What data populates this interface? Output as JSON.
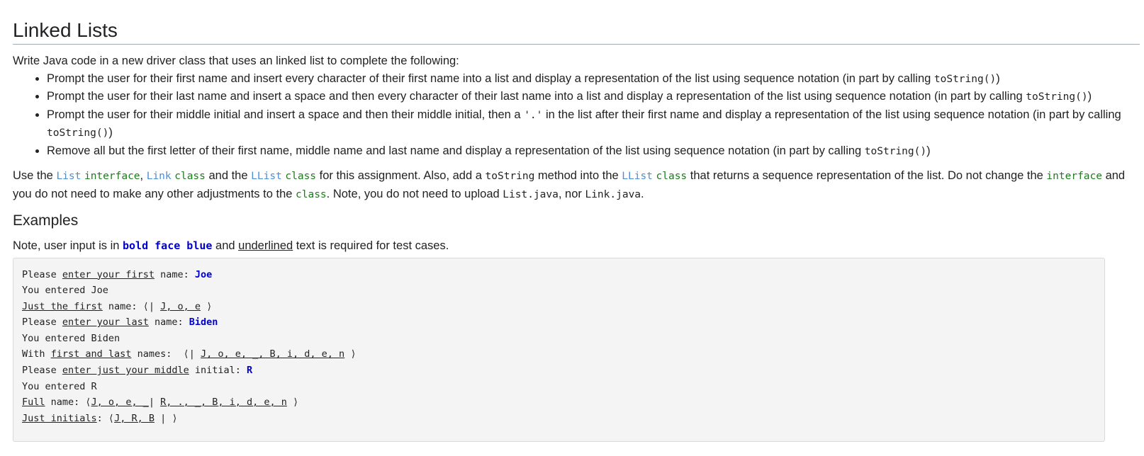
{
  "heading": "Linked Lists",
  "intro": "Write Java code in a new driver class that uses an linked list to complete the following:",
  "bullets": [
    {
      "text": "Prompt the user for their first name and insert every character of their first name into a list and display a representation of the list using sequence notation (in part by calling ",
      "code": "toString()",
      "after": ")"
    },
    {
      "text": "Prompt the user for their last name and insert a space and then every character of their last name into a list and display a representation of the list using sequence notation (in part by calling ",
      "code": "toString()",
      "after": ")"
    },
    {
      "text_a": "Prompt the user for their middle initial and insert a space and then their middle initial, then a ",
      "code_a": "'.'",
      "text_b": " in the list after their first name and display a representation of the list using sequence notation (in part by calling ",
      "code": "toString()",
      "after": ")"
    },
    {
      "text": "Remove all but the first letter of their first name, middle name and last name and display a representation of the list using sequence notation (in part by calling ",
      "code": "toString()",
      "after": ")"
    }
  ],
  "use": {
    "t1": "Use the ",
    "list": "List",
    "interface_word": "interface",
    "comma": ", ",
    "link": "Link",
    "class_word": "class",
    "t2": " and the ",
    "llist": "LList",
    "t3": " for this assignment. Also, add a ",
    "tostring": "toString",
    "t4": " method into the ",
    "t5": " that returns a sequence representation of the list. Do not change the ",
    "t6": " and you do not need to make any other adjustments to the ",
    "t7": ". Note, you do not need to upload ",
    "listjava": "List.java",
    "t8": ", nor ",
    "linkjava": "Link.java",
    "t9": "."
  },
  "examples_heading": "Examples",
  "note": {
    "t1": "Note, user input is in ",
    "bold": "bold face blue",
    "t2": " and ",
    "underlined": "underlined",
    "t3": " text is required for test cases."
  },
  "example": {
    "l1a": "Please ",
    "l1u": "enter your first",
    "l1b": " name: ",
    "l1in": "Joe",
    "l2": "You entered Joe",
    "l3u": "Just the first",
    "l3b": " name: ⟨| ",
    "l3seq": "J, o, e",
    "l3c": " ⟩",
    "l4a": "Please ",
    "l4u": "enter your last",
    "l4b": " name: ",
    "l4in": "Biden",
    "l5": "You entered Biden",
    "l6a": "With ",
    "l6u": "first and last",
    "l6b": " names:  ⟨| ",
    "l6seq": "J, o, e, _, B, i, d, e, n",
    "l6c": " ⟩",
    "l7a": "Please ",
    "l7u": "enter just your middle",
    "l7b": " initial: ",
    "l7in": "R",
    "l8": "You entered R",
    "l9u": "Full",
    "l9b": " name: ⟨",
    "l9seq1": "J, o, e, _",
    "l9bar": "| ",
    "l9seq2": "R, ., _, B, i, d, e, n",
    "l9c": " ⟩",
    "l10u": "Just initials",
    "l10b": ": ⟨",
    "l10seq": "J, R, B",
    "l10c": " | ⟩"
  }
}
